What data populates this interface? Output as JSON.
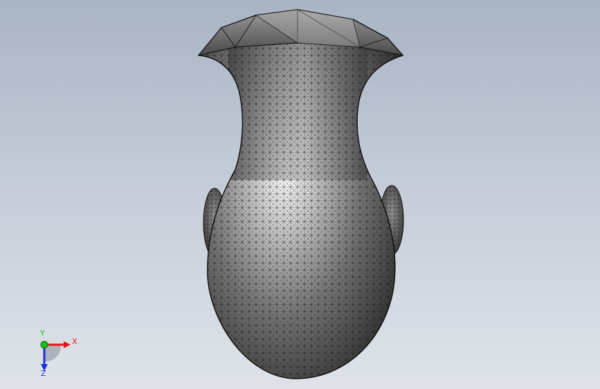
{
  "view": {
    "background_top": "#a9b4c4",
    "background_bottom": "#dfe3e9"
  },
  "model": {
    "name_icon": "vase-mesh-model",
    "mesh_color": "#1a1a1a",
    "surface_color": "#9a9a9a"
  },
  "triad": {
    "x_label": "X",
    "y_label": "Y",
    "z_label": "Z",
    "x_color": "#e01818",
    "y_color": "#18c018",
    "z_color": "#1830d8"
  }
}
